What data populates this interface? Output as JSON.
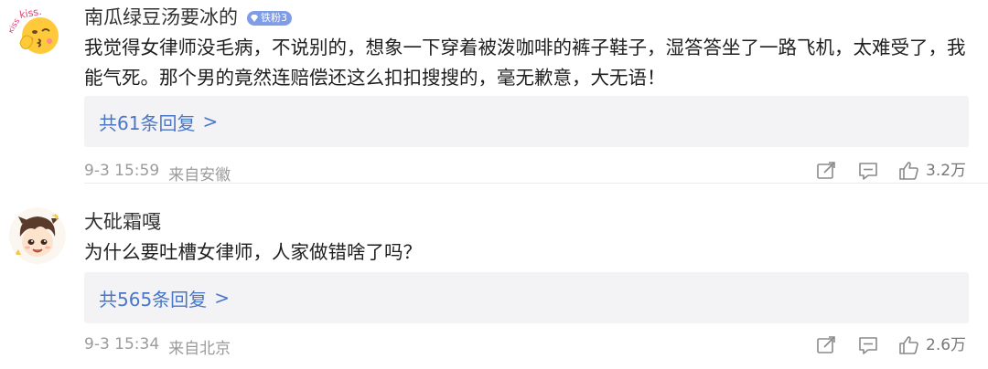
{
  "comments": [
    {
      "username": "南瓜绿豆汤要冰的",
      "fan_badge": "铁粉3",
      "avatar_icon": "kiss-emoji-avatar",
      "avatar_text": "kiss.",
      "content": "我觉得女律师没毛病，不说别的，想象一下穿着被泼咖啡的裤子鞋子，湿答答坐了一路飞机，太难受了，我能气死。那个男的竟然连赔偿还这么扣扣搜搜的，毫无歉意，大无语！",
      "replies": "共61条回复",
      "date": "9-3 15:59",
      "location": "来自安徽",
      "likes": "3.2万"
    },
    {
      "username": "大砒霜嘎",
      "avatar_icon": "cartoon-boy-avatar",
      "content": "为什么要吐槽女律师，人家做错啥了吗？",
      "replies": "共565条回复",
      "date": "9-3 15:34",
      "location": "来自北京",
      "likes": "2.6万"
    }
  ],
  "icons": {
    "share": "share-icon",
    "comment": "comment-icon",
    "like": "thumbs-up-icon",
    "reply_chevron": ">"
  },
  "colors": {
    "link_blue": "#4a76c8",
    "reply_bg": "#f3f3f5",
    "badge_blue": "#7f9ce6",
    "meta_gray": "#9b9b9b"
  }
}
